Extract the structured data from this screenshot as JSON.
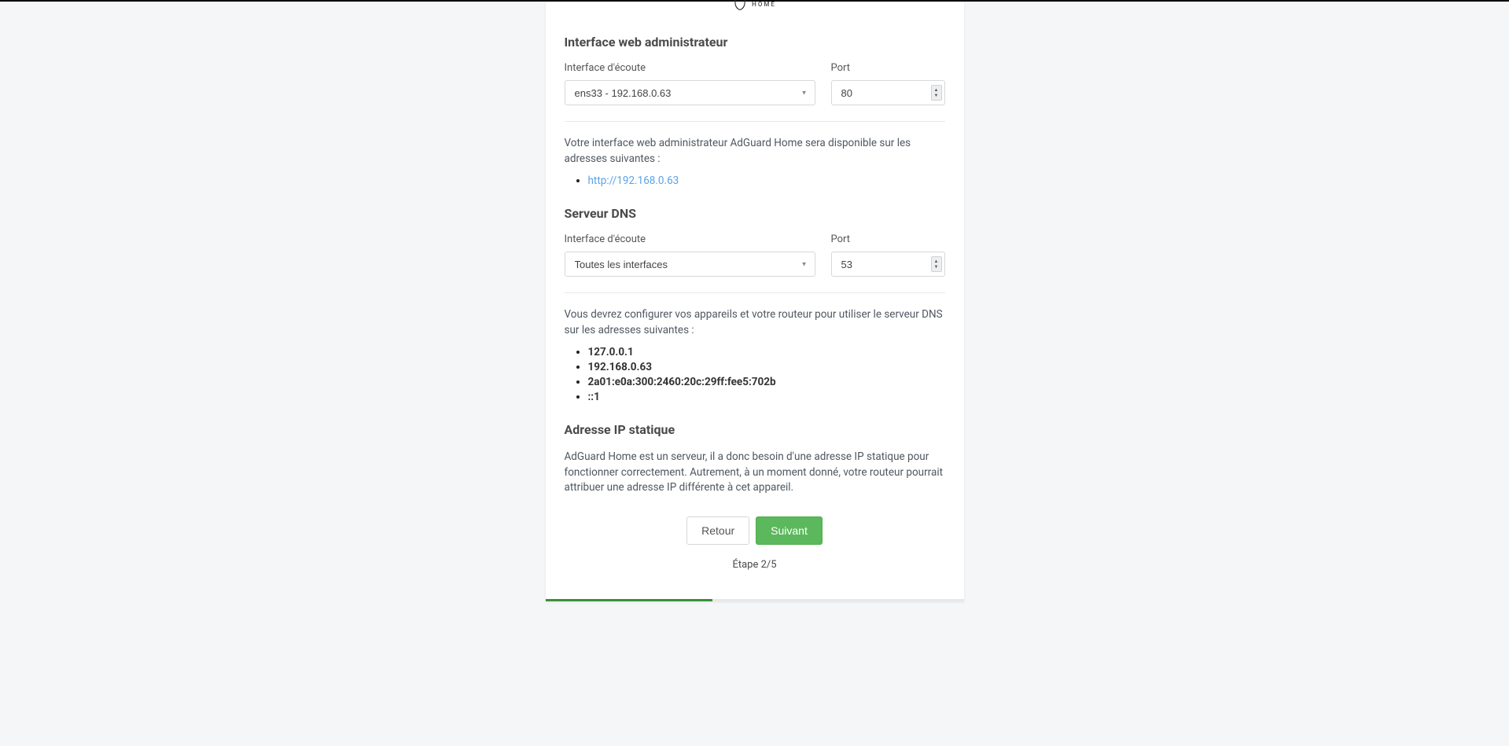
{
  "logo": {
    "line1": "HOME"
  },
  "webInterface": {
    "heading": "Interface web administrateur",
    "interfaceLabel": "Interface d'écoute",
    "interfaceValue": "ens33 - 192.168.0.63",
    "portLabel": "Port",
    "portValue": "80",
    "infoText": "Votre interface web administrateur AdGuard Home sera disponible sur les adresses suivantes :",
    "addresses": [
      "http://192.168.0.63"
    ]
  },
  "dnsServer": {
    "heading": "Serveur DNS",
    "interfaceLabel": "Interface d'écoute",
    "interfaceValue": "Toutes les interfaces",
    "portLabel": "Port",
    "portValue": "53",
    "infoText": "Vous devrez configurer vos appareils et votre routeur pour utiliser le serveur DNS sur les adresses suivantes :",
    "addresses": [
      "127.0.0.1",
      "192.168.0.63",
      "2a01:e0a:300:2460:20c:29ff:fee5:702b",
      "::1"
    ]
  },
  "staticIp": {
    "heading": "Adresse IP statique",
    "text": "AdGuard Home est un serveur, il a donc besoin d'une adresse IP statique pour fonctionner correctement. Autrement, à un moment donné, votre routeur pourrait attribuer une adresse IP différente à cet appareil."
  },
  "buttons": {
    "back": "Retour",
    "next": "Suivant"
  },
  "step": "Étape 2/5"
}
